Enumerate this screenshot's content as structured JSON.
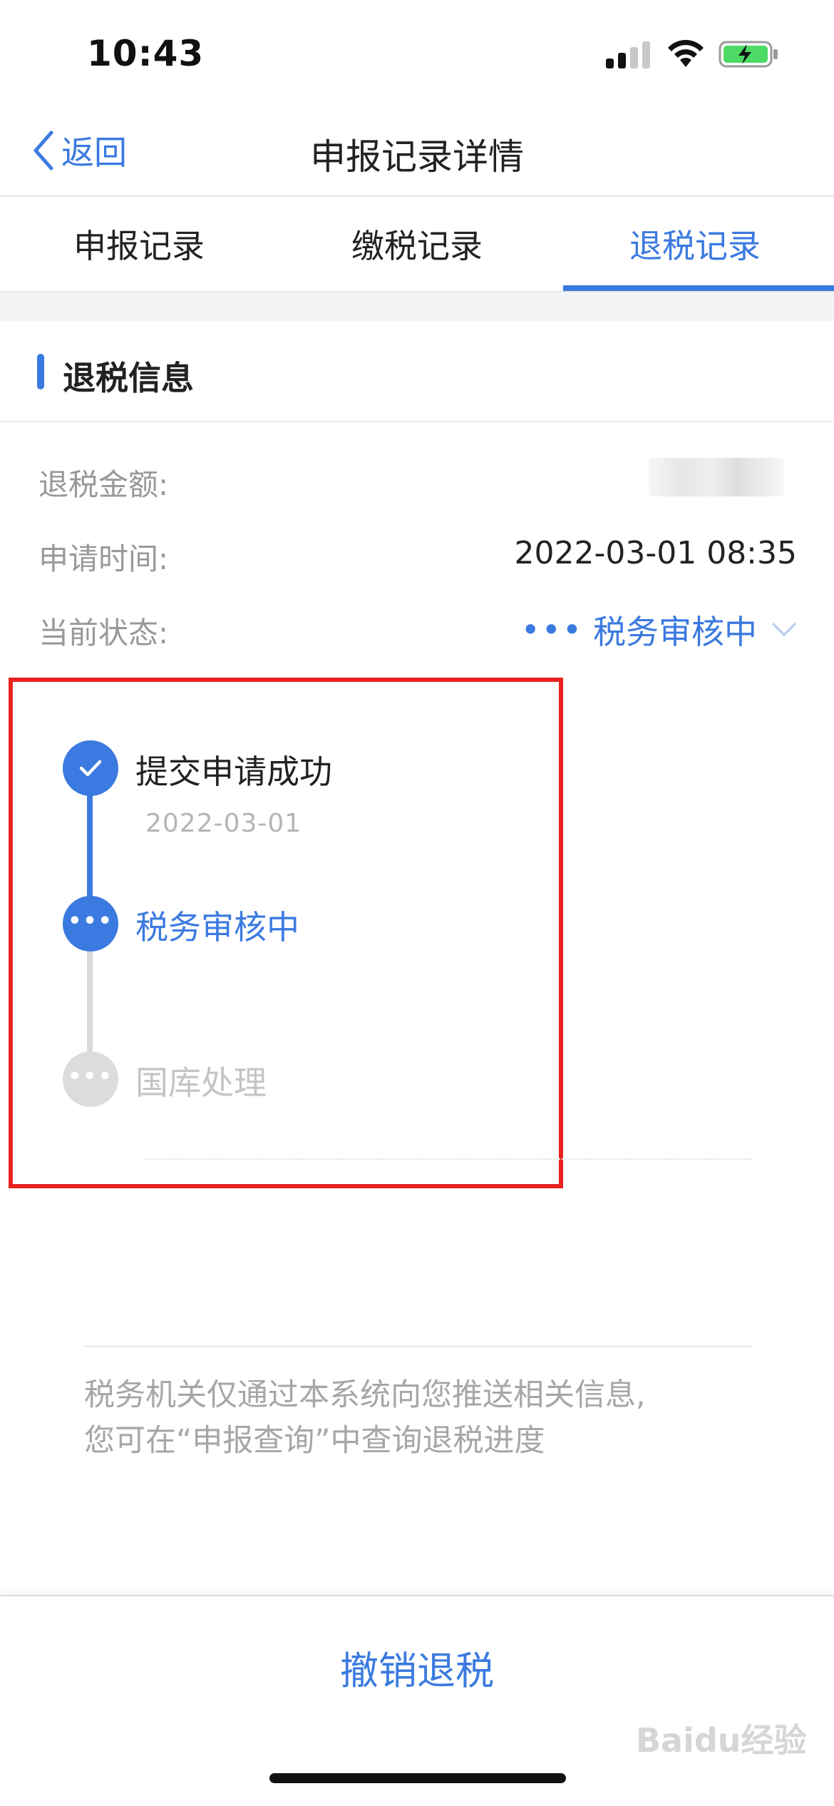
{
  "status_bar": {
    "time": "10:43"
  },
  "nav": {
    "back_label": "返回",
    "title": "申报记录详情"
  },
  "tabs": [
    {
      "label": "申报记录",
      "active": false
    },
    {
      "label": "缴税记录",
      "active": false
    },
    {
      "label": "退税记录",
      "active": true
    }
  ],
  "section": {
    "title": "退税信息"
  },
  "info": {
    "amount_label": "退税金额:",
    "time_label": "申请时间:",
    "time_value": "2022-03-01 08:35",
    "status_label": "当前状态:",
    "status_value": "税务审核中"
  },
  "timeline": [
    {
      "label": "提交申请成功",
      "date": "2022-03-01",
      "state": "done"
    },
    {
      "label": "税务审核中",
      "state": "current"
    },
    {
      "label": "国库处理",
      "state": "pending"
    }
  ],
  "note": {
    "line1": "税务机关仅通过本系统向您推送相关信息,",
    "line2": "您可在“申报查询”中查询退税进度"
  },
  "footer": {
    "cancel_label": "撤销退税"
  },
  "watermark": "Baidu经验",
  "colors": {
    "accent": "#3b7ae0",
    "highlight": "#e8231f",
    "pending": "#d9d9d9"
  }
}
